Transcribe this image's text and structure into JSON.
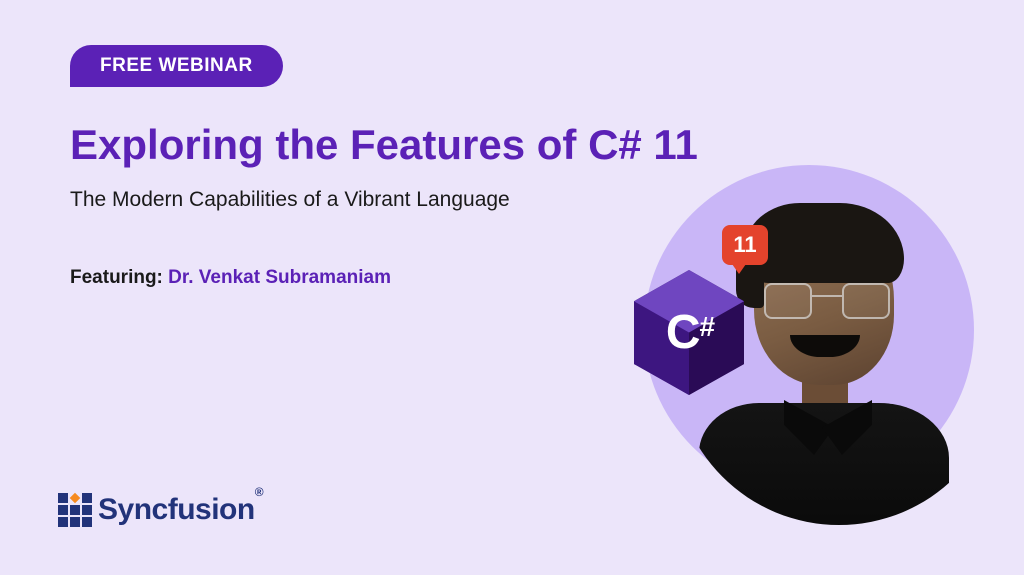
{
  "badge": "FREE WEBINAR",
  "title": "Exploring the Features of C# 11",
  "subtitle": "The Modern Capabilities of a Vibrant Language",
  "featuring_label": "Featuring: ",
  "speaker_name": "Dr. Venkat Subramaniam",
  "csharp": {
    "letter": "C",
    "hash": "#",
    "version": "11"
  },
  "brand": "Syncfusion",
  "brand_mark": "®"
}
